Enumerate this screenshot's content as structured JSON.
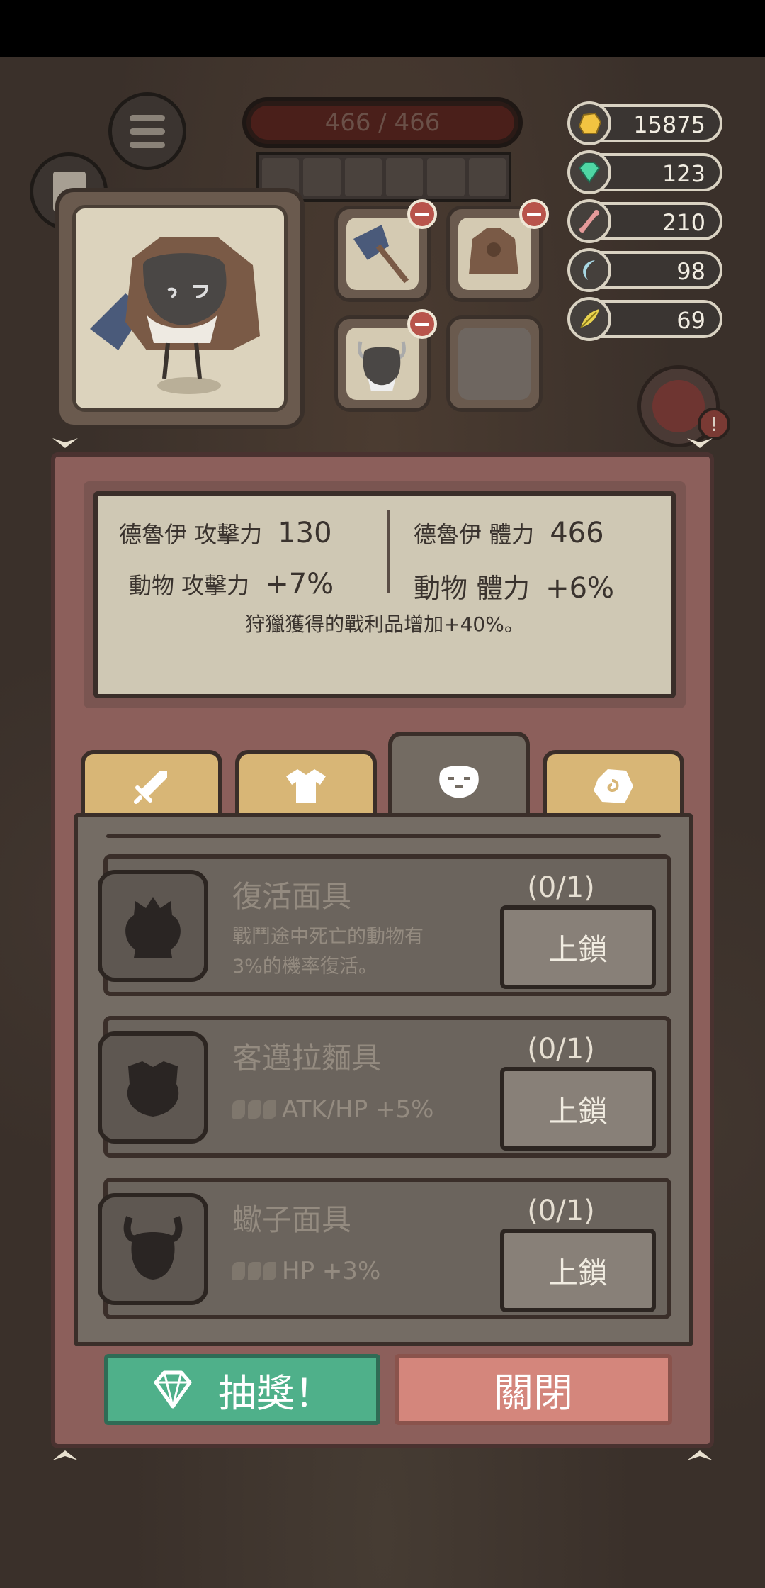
{
  "hud": {
    "hp_text": "466 / 466"
  },
  "resources": [
    {
      "name": "gold-nugget",
      "value": "15875",
      "color": "#f2c341"
    },
    {
      "name": "green-gem",
      "value": "123",
      "color": "#4fd6a4"
    },
    {
      "name": "bone",
      "value": "210",
      "color": "#e59a9a"
    },
    {
      "name": "claw",
      "value": "98",
      "color": "#a8d8e4"
    },
    {
      "name": "feather",
      "value": "69",
      "color": "#e8d24e"
    }
  ],
  "stats": {
    "druid_atk_label": "德魯伊 攻擊力",
    "druid_atk_value": "130",
    "druid_hp_label": "德魯伊 體力",
    "druid_hp_value": "466",
    "animal_atk_label": "動物 攻擊力",
    "animal_atk_value": "+7%",
    "animal_hp_label": "動物 體力",
    "animal_hp_value": "+6%",
    "bonus_text": "狩獵獲得的戰利品增加+40%。"
  },
  "tabs": [
    {
      "icon": "sword-icon",
      "active": false
    },
    {
      "icon": "armor-icon",
      "active": false
    },
    {
      "icon": "skull-mask-icon",
      "active": true
    },
    {
      "icon": "rune-stone-icon",
      "active": false
    }
  ],
  "masks": [
    {
      "name": "復活面具",
      "desc": "戰鬥途中死亡的動物有3%的機率復活。",
      "stat": "",
      "count": "(0/1)",
      "button": "上鎖"
    },
    {
      "name": "客邁拉麵具",
      "desc": "",
      "stat": "ATK/HP +5%",
      "count": "(0/1)",
      "button": "上鎖"
    },
    {
      "name": "蠍子面具",
      "desc": "",
      "stat": "HP +3%",
      "count": "(0/1)",
      "button": "上鎖"
    }
  ],
  "buttons": {
    "draw": "抽獎！",
    "close": "關閉"
  },
  "colors": {
    "panel": "#8c5f5b",
    "draw_button": "#4fb08a",
    "close_button": "#d4867c",
    "tab": "#d8b676"
  }
}
